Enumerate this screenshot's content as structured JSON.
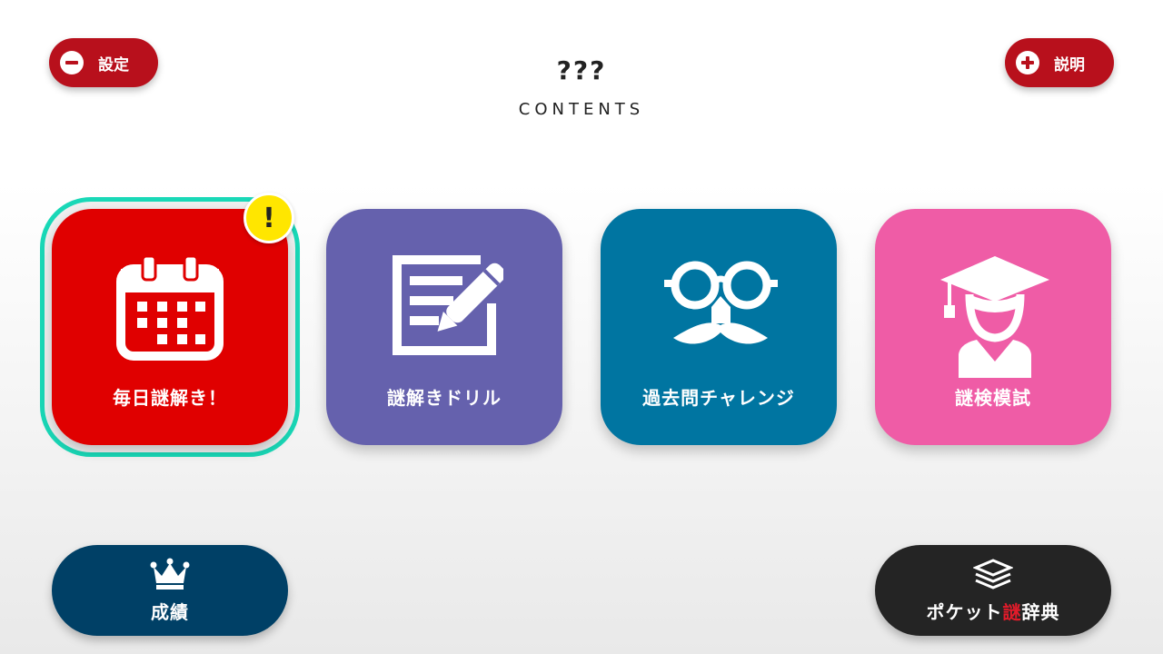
{
  "header": {
    "logo_mark": "???",
    "logo_text": "CONTENTS",
    "settings_label": "設定",
    "help_label": "説明"
  },
  "tiles": [
    {
      "label": "毎日謎解き！",
      "icon": "calendar-icon",
      "color": "#e00000",
      "selected": true,
      "alert": "!"
    },
    {
      "label": "謎解きドリル",
      "icon": "notebook-pen-icon",
      "color": "#6561ad"
    },
    {
      "label": "過去問チャレンジ",
      "icon": "glasses-mustache-icon",
      "color": "#0075a1"
    },
    {
      "label": "謎検模試",
      "icon": "graduate-icon",
      "color": "#ef5ca6"
    }
  ],
  "bottom": {
    "results_label": "成績",
    "results_icon": "crown-icon",
    "dictionary_label_pre": "ポケット",
    "dictionary_label_hl": "謎",
    "dictionary_label_post": "辞典",
    "dictionary_icon": "book-stack-icon"
  },
  "colors": {
    "accent_red": "#b8101c",
    "selection": "#19d8b7",
    "alert": "#ffe600"
  }
}
